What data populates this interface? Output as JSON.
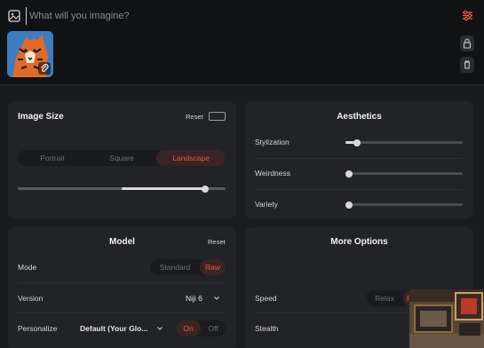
{
  "prompt": {
    "placeholder": "What will you imagine?"
  },
  "image_size": {
    "title": "Image Size",
    "reset_label": "Reset",
    "orientations": [
      "Portrait",
      "Square",
      "Landscape"
    ],
    "selected": "Landscape",
    "aspect_slider_value": 0.9
  },
  "aesthetics": {
    "title": "Aesthetics",
    "sliders": [
      {
        "label": "Stylization",
        "value": 0.1
      },
      {
        "label": "Weirdness",
        "value": 0.0
      },
      {
        "label": "Variety",
        "value": 0.0
      }
    ]
  },
  "model": {
    "title": "Model",
    "reset_label": "Reset",
    "mode_label": "Mode",
    "mode_options": [
      "Standard",
      "Raw"
    ],
    "mode_selected": "Raw",
    "version_label": "Version",
    "version_value": "Niji 6",
    "personalize_label": "Personalize",
    "personalize_value": "Default (Your Glo...",
    "personalize_toggle": [
      "On",
      "Off"
    ],
    "personalize_selected": "On"
  },
  "more_options": {
    "title": "More Options",
    "speed_label": "Speed",
    "speed_options": [
      "Relax",
      "F"
    ],
    "stealth_label": "Stealth"
  },
  "colors": {
    "accent": "#ea5a47",
    "panel": "#222327",
    "background": "#1b1c20"
  }
}
